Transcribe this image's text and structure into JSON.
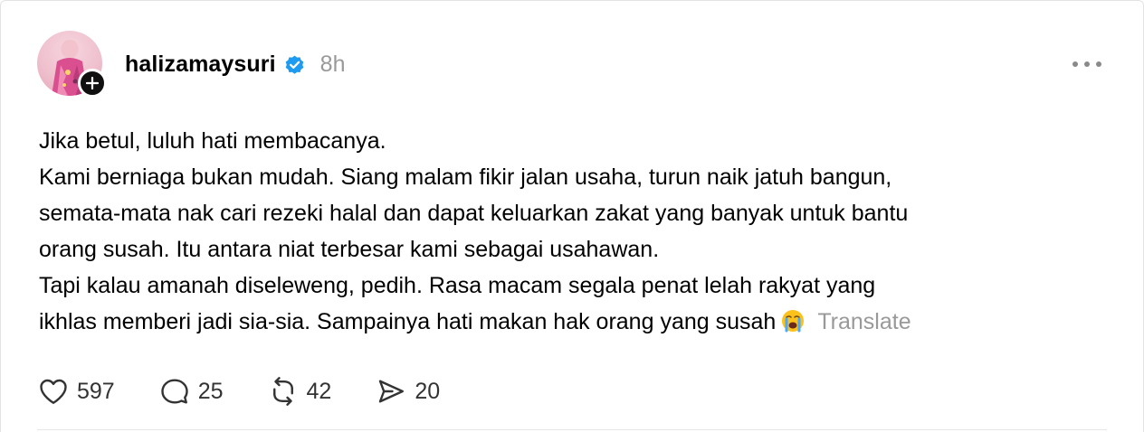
{
  "post": {
    "username": "halizamaysuri",
    "time": "8h",
    "verified": true,
    "lines": [
      "Jika betul, luluh hati membacanya.",
      "Kami berniaga bukan mudah. Siang malam fikir jalan usaha, turun naik jatuh bangun,",
      "semata-mata nak cari rezeki halal dan dapat keluarkan zakat yang banyak untuk bantu",
      "orang susah. Itu antara niat terbesar kami sebagai usahawan.",
      "Tapi kalau amanah diseleweng, pedih. Rasa macam segala penat lelah rakyat yang",
      "ikhlas memberi jadi sia-sia. Sampainya hati makan hak orang yang susah"
    ],
    "emoji": "loudly-crying-face",
    "translate_label": "Translate"
  },
  "actions": {
    "likes": "597",
    "replies": "25",
    "reposts": "42",
    "shares": "20"
  },
  "colors": {
    "verified_badge": "#1d9bf0",
    "muted_text": "#999999",
    "follow_badge": "#101010"
  },
  "icons": {
    "more": "ellipsis-icon",
    "follow": "plus-icon",
    "like": "heart-icon",
    "reply": "comment-icon",
    "repost": "repost-icon",
    "share": "send-icon"
  }
}
